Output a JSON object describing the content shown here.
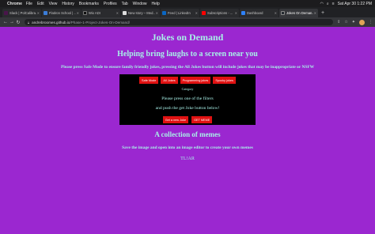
{
  "menubar": {
    "app": "Chrome",
    "items": [
      "File",
      "Edit",
      "View",
      "History",
      "Bookmarks",
      "Profiles",
      "Tab",
      "Window",
      "Help"
    ],
    "datetime": "Sat Apr 30  1:22 PM"
  },
  "tabs": [
    {
      "label": "Slack | PolCalibra...",
      "color": "#4a154b"
    },
    {
      "label": "Flatiron School | ...",
      "color": "#3b7dd8"
    },
    {
      "label": "Wix ADI",
      "color": "#111111"
    },
    {
      "label": "New story – Med...",
      "color": "#dddddd"
    },
    {
      "label": "Feed | LinkedIn",
      "color": "#0a66c2"
    },
    {
      "label": "Subscriptions - ...",
      "color": "#ff0000"
    },
    {
      "label": "Dashboard",
      "color": "#2f81f7"
    },
    {
      "label": "Jokes On Deman...",
      "color": "#24292f"
    }
  ],
  "address": {
    "host": "andrebroomes.github.io",
    "path": "/Phase-1-Project-Jokes-On-Demand/"
  },
  "page": {
    "title": "Jokes on Demand",
    "subtitle": "Helping bring laughs to a screen near you",
    "intro": "Please press Safe Mode to ensure family friendly jokes, pressing the All Jokes button will include jokes that may be inappropriate or NSFW",
    "filters": [
      "Safe Mode",
      "All Jokes",
      "Programming jokes",
      "Spooky jokes"
    ],
    "category": "Category",
    "message1": "Please press one of the filters",
    "message2": "and push the get Joke button below!",
    "get_joke": "Get a new Joke",
    "get_meme": "GET MEME",
    "memes_heading": "A collection of memes",
    "memes_text": "Save the image and open into an image editor to create your own memes",
    "tlar": "TL!AR"
  }
}
